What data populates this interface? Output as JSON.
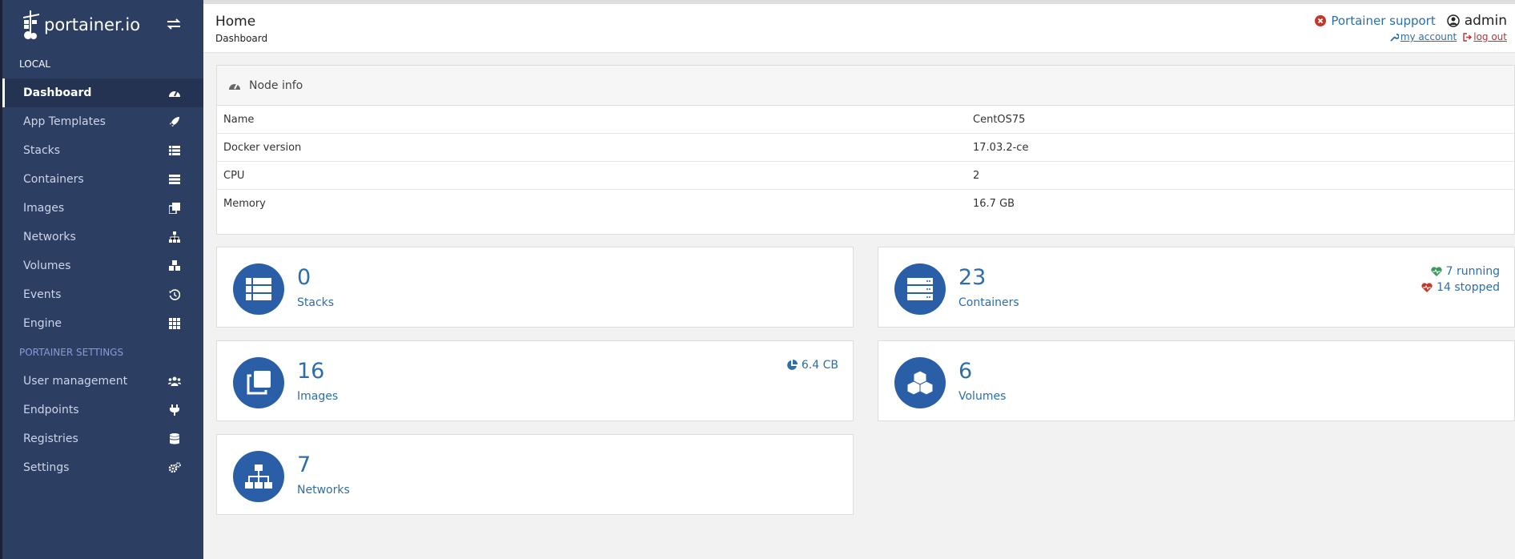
{
  "sidebar": {
    "brand": "portainer.io",
    "section_local": "LOCAL",
    "section_settings": "PORTAINER SETTINGS",
    "items": [
      {
        "label": "Dashboard",
        "icon": "tachometer-icon"
      },
      {
        "label": "App Templates",
        "icon": "rocket-icon"
      },
      {
        "label": "Stacks",
        "icon": "list-icon"
      },
      {
        "label": "Containers",
        "icon": "server-icon"
      },
      {
        "label": "Images",
        "icon": "clone-icon"
      },
      {
        "label": "Networks",
        "icon": "sitemap-icon"
      },
      {
        "label": "Volumes",
        "icon": "cubes-icon"
      },
      {
        "label": "Events",
        "icon": "history-icon"
      },
      {
        "label": "Engine",
        "icon": "grid-icon"
      }
    ],
    "settings_items": [
      {
        "label": "User management",
        "icon": "users-icon"
      },
      {
        "label": "Endpoints",
        "icon": "plug-icon"
      },
      {
        "label": "Registries",
        "icon": "database-icon"
      },
      {
        "label": "Settings",
        "icon": "cogs-icon"
      }
    ]
  },
  "header": {
    "title": "Home",
    "breadcrumb": "Dashboard",
    "support": "Portainer support",
    "user": "admin",
    "my_account": "my account",
    "log_out": "log out"
  },
  "node_info": {
    "title": "Node info",
    "rows": [
      {
        "key": "Name",
        "value": "CentOS75"
      },
      {
        "key": "Docker version",
        "value": "17.03.2-ce"
      },
      {
        "key": "CPU",
        "value": "2"
      },
      {
        "key": "Memory",
        "value": "16.7 GB"
      }
    ]
  },
  "cards": {
    "stacks": {
      "count": "0",
      "label": "Stacks"
    },
    "containers": {
      "count": "23",
      "label": "Containers",
      "running": "7 running",
      "stopped": "14 stopped"
    },
    "images": {
      "count": "16",
      "label": "Images",
      "size": "6.4 CB"
    },
    "volumes": {
      "count": "6",
      "label": "Volumes"
    },
    "networks": {
      "count": "7",
      "label": "Networks"
    }
  },
  "colors": {
    "sidebar": "#2d3e63",
    "accent": "#2d6ea8",
    "icon_circle": "#2a5fa8",
    "running": "#3a9a5c",
    "stopped": "#c0392b"
  }
}
